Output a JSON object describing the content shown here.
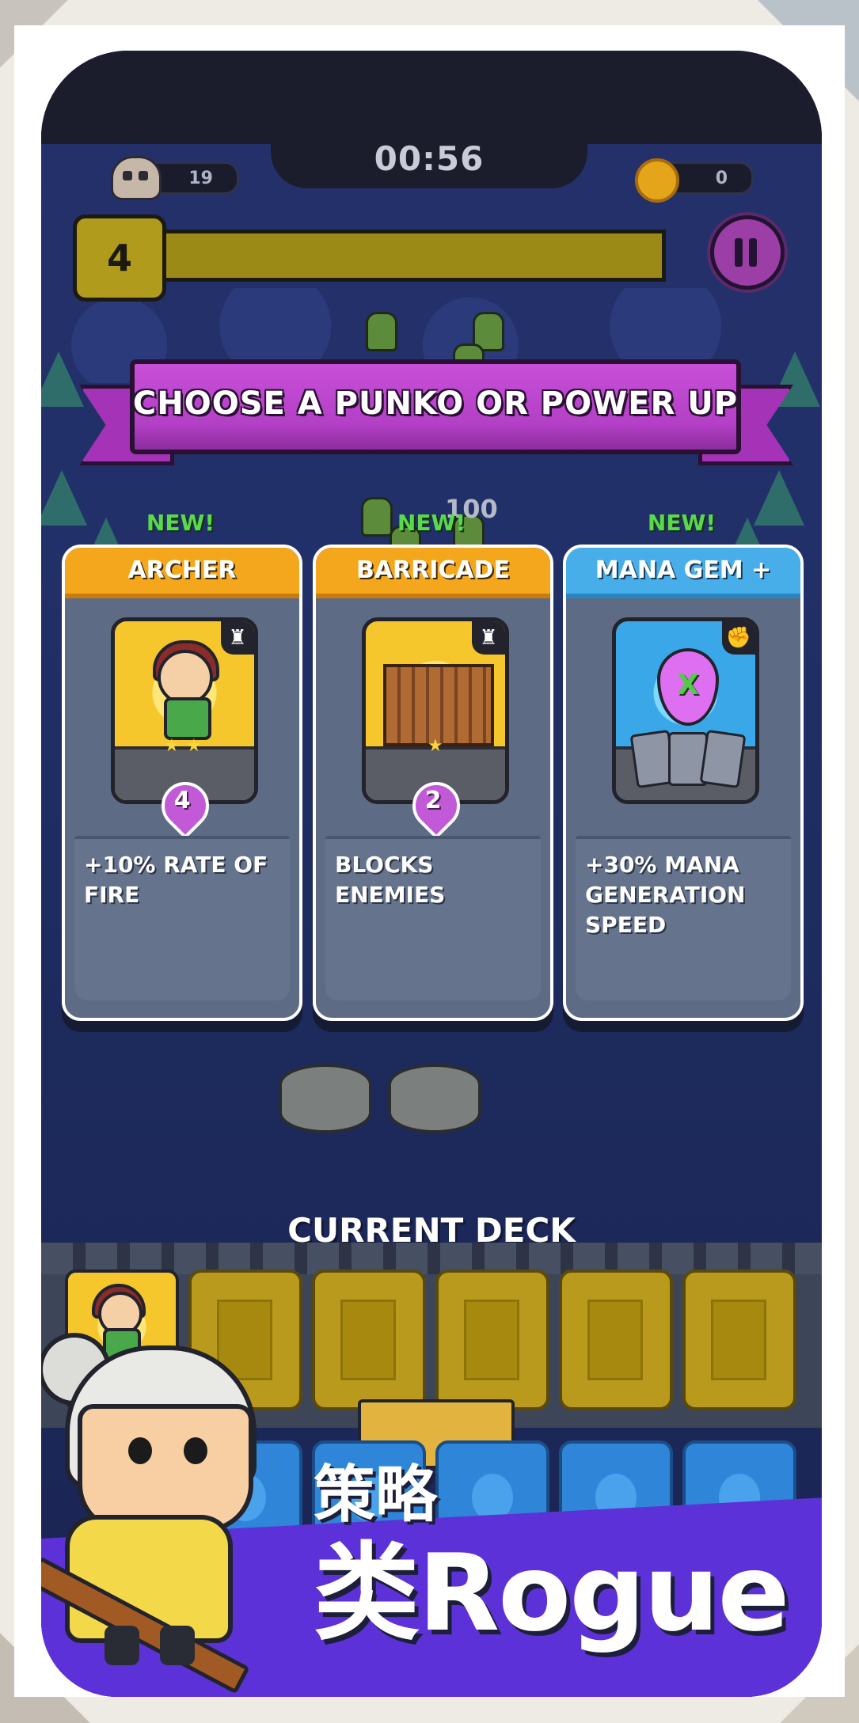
{
  "hud": {
    "timer": "00:56",
    "kills": "19",
    "coins": "0",
    "level": "4"
  },
  "banner": {
    "title": "CHOOSE A PUNKO OR POWER UP"
  },
  "floating_text": "100",
  "cards": [
    {
      "badge": "NEW!",
      "title": "ARCHER",
      "mana_cost": "4",
      "stars": 2,
      "description": "+10% RATE OF FIRE",
      "header_color": "#f4a71d",
      "type_icon": "tower-icon"
    },
    {
      "badge": "NEW!",
      "title": "BARRICADE",
      "mana_cost": "2",
      "stars": 1,
      "description": "BLOCKS ENEMIES",
      "header_color": "#f4a71d",
      "type_icon": "tower-icon"
    },
    {
      "badge": "NEW!",
      "title": "MANA GEM +",
      "description": "+30% MANA GENERATION SPEED",
      "header_color": "#47aeea",
      "type_icon": "power-fist-icon",
      "art_letter": "X"
    }
  ],
  "deck": {
    "title": "CURRENT DECK",
    "slots": [
      "archer",
      "empty",
      "empty",
      "empty",
      "empty",
      "empty"
    ]
  },
  "promo": {
    "line1": "策略",
    "line2": "类Rogue"
  },
  "colors": {
    "banner_purple": "#b340c6",
    "promo_purple": "#5d31d8",
    "deck_gold": "#b99a1d",
    "new_green": "#59d94b"
  }
}
